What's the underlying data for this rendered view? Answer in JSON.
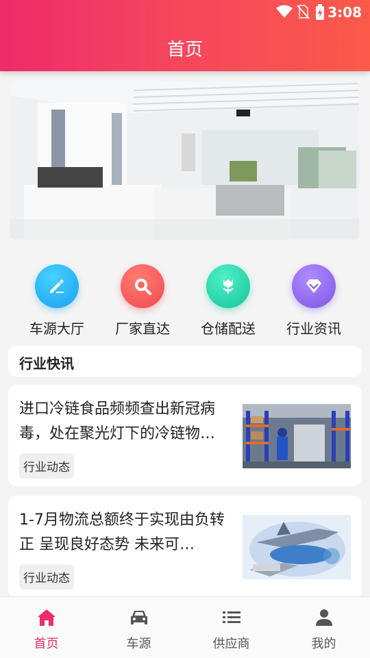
{
  "status": {
    "time": "3:08"
  },
  "header": {
    "title": "首页"
  },
  "quick": [
    {
      "label": "车源大厅",
      "icon": "edit-icon"
    },
    {
      "label": "厂家直达",
      "icon": "search-icon"
    },
    {
      "label": "仓储配送",
      "icon": "tulip-icon"
    },
    {
      "label": "行业资讯",
      "icon": "diamond-icon"
    }
  ],
  "section": {
    "title": "行业快讯"
  },
  "news": [
    {
      "title": "进口冷链食品频频查出新冠病毒，处在聚光灯下的冷链物…",
      "tag": "行业动态"
    },
    {
      "title": "1-7月物流总额终于实现由负转正 呈现良好态势 未来可…",
      "tag": "行业动态"
    }
  ],
  "tabs": [
    {
      "label": "首页",
      "icon": "home-icon",
      "active": true
    },
    {
      "label": "车源",
      "icon": "car-icon",
      "active": false
    },
    {
      "label": "供应商",
      "icon": "list-icon",
      "active": false
    },
    {
      "label": "我的",
      "icon": "person-icon",
      "active": false
    }
  ],
  "colors": {
    "accent": "#ee2b6b",
    "header_start": "#ee2b6b",
    "header_end": "#fb5a4a"
  }
}
